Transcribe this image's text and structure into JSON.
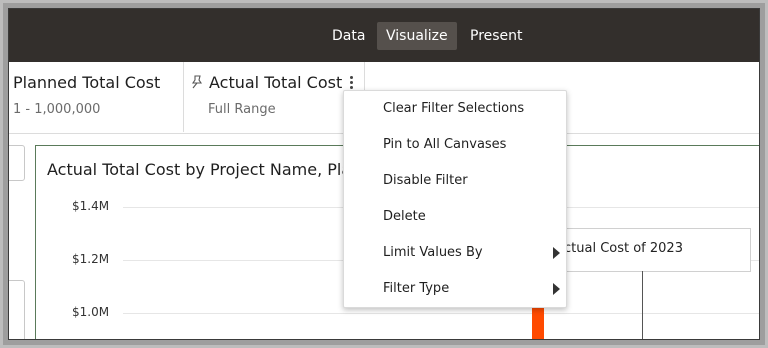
{
  "topbar": {
    "modes": [
      "Data",
      "Visualize",
      "Present"
    ],
    "active_mode": "Visualize"
  },
  "filters": [
    {
      "title": "Planned Total Cost",
      "value": "1 - 1,000,000"
    },
    {
      "title": "Actual Total Cost",
      "value": "Full Range",
      "pinned_icon": "pin-icon",
      "menu_icon": "kebab-icon"
    }
  ],
  "visualization": {
    "title": "Actual Total Cost by Project Name, Pla",
    "y_ticks": [
      "$1.4M",
      "$1.2M",
      "$1.0M"
    ],
    "annotation": "ctual Cost of 2023",
    "bar_color": "#ff4a00"
  },
  "context_menu": {
    "items": [
      {
        "label": "Clear Filter Selections",
        "submenu": false
      },
      {
        "label": "Pin to All Canvases",
        "submenu": false
      },
      {
        "label": "Disable Filter",
        "submenu": false
      },
      {
        "label": "Delete",
        "submenu": false
      },
      {
        "label": "Limit Values By",
        "submenu": true
      },
      {
        "label": "Filter Type",
        "submenu": true
      }
    ]
  },
  "colors": {
    "topbar_bg": "#332f2c",
    "active_mode_bg": "#55504c",
    "accent_bar": "#ff4a00"
  }
}
